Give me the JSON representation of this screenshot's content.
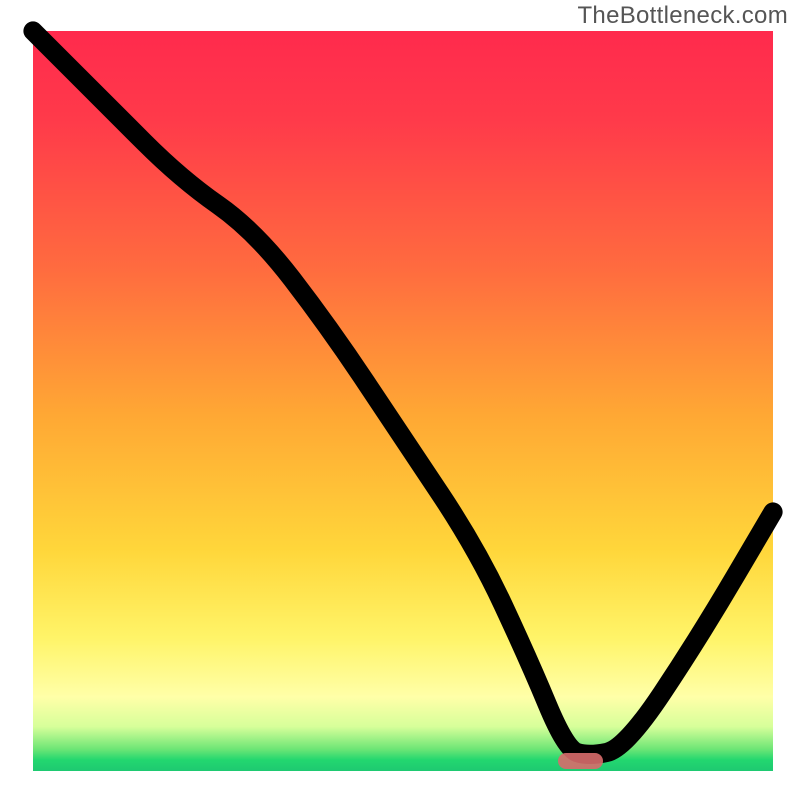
{
  "watermark": "TheBottleneck.com",
  "chart_data": {
    "type": "line",
    "title": "",
    "xlabel": "",
    "ylabel": "",
    "xlim": [
      0,
      100
    ],
    "ylim": [
      0,
      100
    ],
    "grid": false,
    "series": [
      {
        "name": "bottleneck-curve",
        "x": [
          0,
          10,
          20,
          30,
          40,
          50,
          60,
          67,
          72,
          75,
          80,
          90,
          100
        ],
        "y": [
          100,
          90,
          80,
          73,
          60,
          45,
          30,
          15,
          3,
          2,
          3,
          18,
          35
        ]
      }
    ],
    "marker": {
      "name": "optimal-point",
      "x_center": 74,
      "width_pct": 6,
      "y": 1.3,
      "color": "#d86b6b"
    },
    "background_gradient": {
      "direction": "vertical",
      "stops": [
        {
          "pos": 0,
          "color": "#ff2a4d"
        },
        {
          "pos": 0.32,
          "color": "#ff6b3f"
        },
        {
          "pos": 0.7,
          "color": "#ffd63a"
        },
        {
          "pos": 0.9,
          "color": "#ffffa8"
        },
        {
          "pos": 0.985,
          "color": "#23d76f"
        },
        {
          "pos": 1.0,
          "color": "#1ec971"
        }
      ]
    }
  }
}
